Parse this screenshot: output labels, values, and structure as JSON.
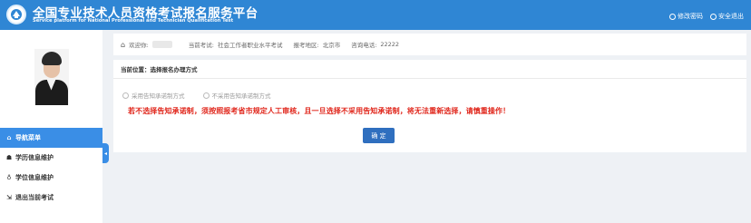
{
  "header": {
    "title": "全国专业技术人员资格考试报名服务平台",
    "subtitle": "Service platform for National Professional and Technician Qualification Test",
    "change_password": "修改密码",
    "logout": "安全退出"
  },
  "sidebar": {
    "items": [
      {
        "icon": "home-icon",
        "glyph": "⌂",
        "label": "导航菜单"
      },
      {
        "icon": "graduation-cap-icon",
        "glyph": "☗",
        "label": "学历信息维护"
      },
      {
        "icon": "degree-icon",
        "glyph": "♁",
        "label": "学位信息维护"
      },
      {
        "icon": "exit-icon",
        "glyph": "⇲",
        "label": "退出当前考试"
      }
    ]
  },
  "infobar": {
    "welcome_label": "欢迎你:",
    "exam_label": "当前考试:",
    "exam_value": "社会工作者职业水平考试",
    "region_label": "报考地区:",
    "region_value": "北京市",
    "phone_label": "咨询电话:",
    "phone_value": "22222"
  },
  "panel": {
    "location": "当前位置：选择报名办理方式",
    "option1": "采用告知承诺制方式",
    "option2": "不采用告知承诺制方式",
    "warning": "若不选择告知承诺制，须按照报考省市规定人工审核，且一旦选择不采用告知承诺制，将无法重新选择，请慎重操作！",
    "confirm": "确 定"
  },
  "colors": {
    "header": "#2f86d4",
    "active_nav": "#3a8ee6",
    "warning": "#e0261b",
    "button": "#2f6fbf"
  }
}
